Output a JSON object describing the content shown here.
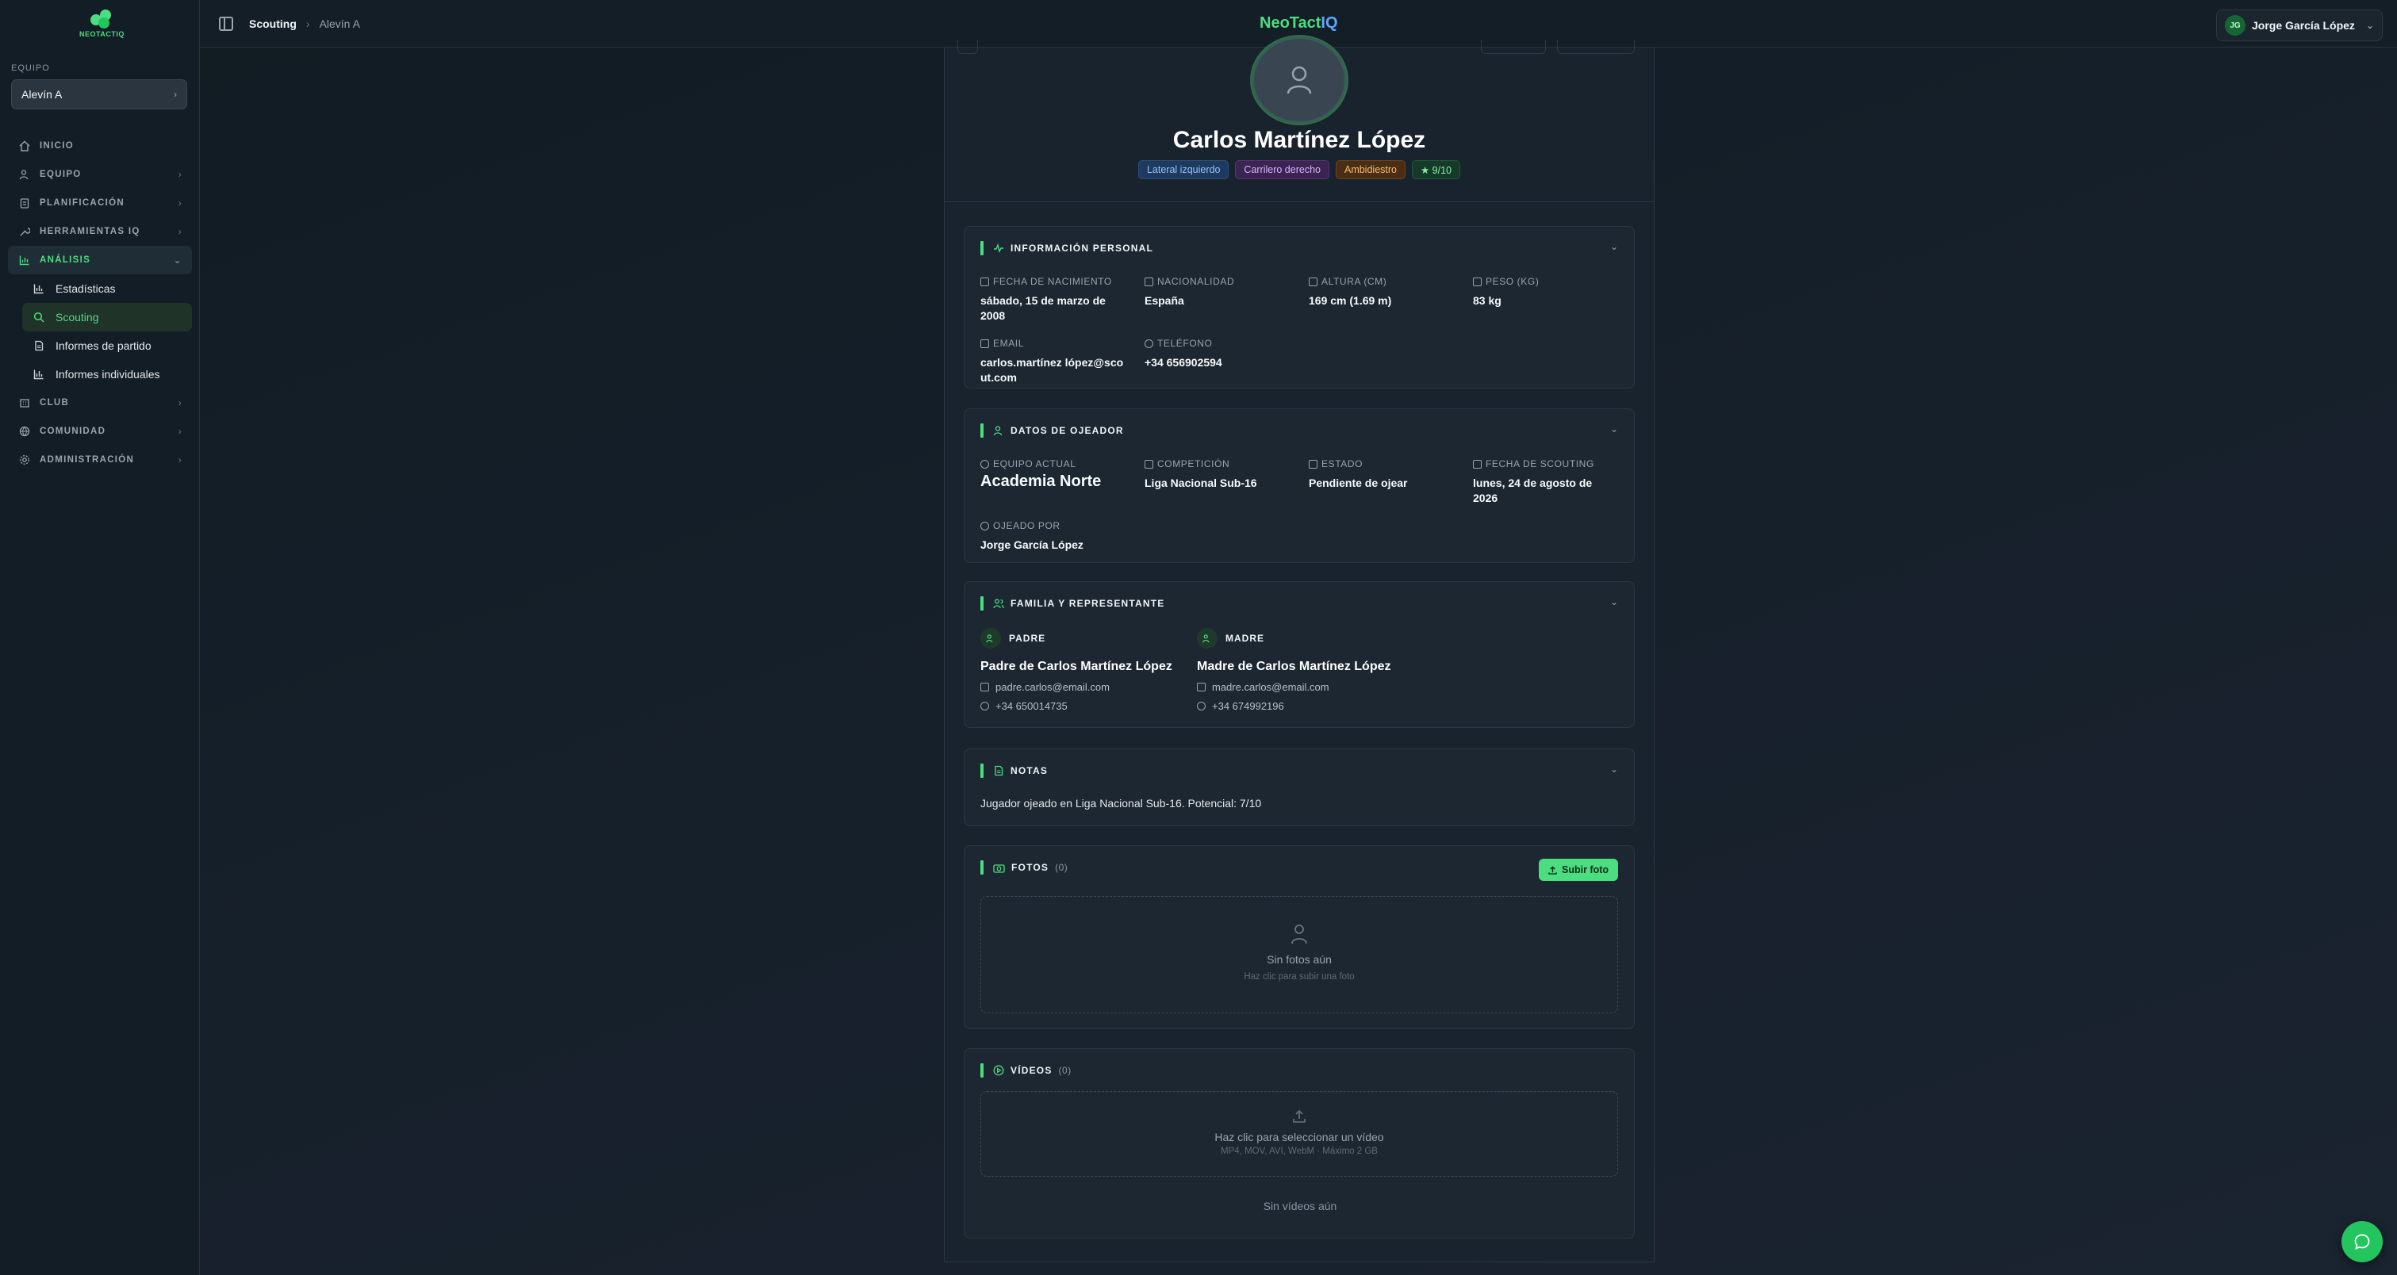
{
  "app": {
    "brand_part1": "NeoTact",
    "brand_part2": "IQ",
    "logo_text": "NEOTACTIQ"
  },
  "sidebar": {
    "team_label": "EQUIPO",
    "team_selected": "Alevín A",
    "items": [
      {
        "label": "INICIO",
        "icon": "home-icon"
      },
      {
        "label": "EQUIPO",
        "icon": "users-icon"
      },
      {
        "label": "PLANIFICACIÓN",
        "icon": "clipboard-icon"
      },
      {
        "label": "HERRAMIENTAS IQ",
        "icon": "wrench-icon"
      },
      {
        "label": "ANÁLISIS",
        "icon": "chart-icon",
        "active": true
      },
      {
        "label": "CLUB",
        "icon": "building-icon"
      },
      {
        "label": "COMUNIDAD",
        "icon": "globe-icon"
      },
      {
        "label": "ADMINISTRACIÓN",
        "icon": "gear-icon"
      }
    ],
    "sub_items": [
      {
        "label": "Estadísticas",
        "icon": "bar-chart-icon"
      },
      {
        "label": "Scouting",
        "icon": "search-icon",
        "active": true
      },
      {
        "label": "Informes de partido",
        "icon": "document-icon"
      },
      {
        "label": "Informes individuales",
        "icon": "bar-chart-icon"
      }
    ]
  },
  "topbar": {
    "breadcrumb_current": "Scouting",
    "breadcrumb_sub": "Alevín A",
    "user_initials": "JG",
    "user_name": "Jorge García López"
  },
  "player": {
    "name": "Carlos Martínez López",
    "tags": [
      "Lateral izquierdo",
      "Carrilero derecho",
      "Ambidiestro",
      "★ 9/10"
    ]
  },
  "personal": {
    "title": "INFORMACIÓN PERSONAL",
    "birth_label": "FECHA DE NACIMIENTO",
    "birth_line1": "sábado, 15 de marzo de",
    "birth_line2": "2008",
    "nationality_label": "NACIONALIDAD",
    "nationality": "España",
    "height_label": "ALTURA (CM)",
    "height": "169 cm (1.69 m)",
    "weight_label": "PESO (KG)",
    "weight": "83 kg",
    "email_label": "EMAIL",
    "email_line1": "carlos.martínez lópez@sco",
    "email_line2": "ut.com",
    "phone_label": "TELÉFONO",
    "phone": "+34 656902594"
  },
  "scout": {
    "title": "DATOS DE OJEADOR",
    "team_label": "EQUIPO ACTUAL",
    "team": "Academia Norte",
    "competition_label": "COMPETICIÓN",
    "competition": "Liga Nacional Sub-16",
    "status_label": "ESTADO",
    "status": "Pendiente de ojear",
    "date_label": "FECHA DE SCOUTING",
    "date_line1": "lunes, 24 de agosto de",
    "date_line2": "2026",
    "scouted_by_label": "OJEADO POR",
    "scouted_by": "Jorge García López"
  },
  "family": {
    "title": "FAMILIA Y REPRESENTANTE",
    "father_role": "PADRE",
    "father_name": "Padre de Carlos Martínez López",
    "father_email": "padre.carlos@email.com",
    "father_phone": "+34 650014735",
    "mother_role": "MADRE",
    "mother_name": "Madre de Carlos Martínez López",
    "mother_email": "madre.carlos@email.com",
    "mother_phone": "+34 674992196"
  },
  "notes": {
    "title": "NOTAS",
    "text": "Jugador ojeado en Liga Nacional Sub-16. Potencial: 7/10"
  },
  "photos": {
    "title": "FOTOS",
    "count": "(0)",
    "upload_label": "Subir foto",
    "empty_main": "Sin fotos aún",
    "empty_sub": "Haz clic para subir una foto"
  },
  "videos": {
    "title": "VÍDEOS",
    "count": "(0)",
    "drop_main": "Haz clic para seleccionar un vídeo",
    "drop_sub": "MP4, MOV, AVI, WebM · Máximo 2 GB",
    "empty": "Sin vídeos aún"
  },
  "colors": {
    "accent": "#4ade80",
    "brand_blue": "#60a5fa",
    "background": "#151f29"
  }
}
